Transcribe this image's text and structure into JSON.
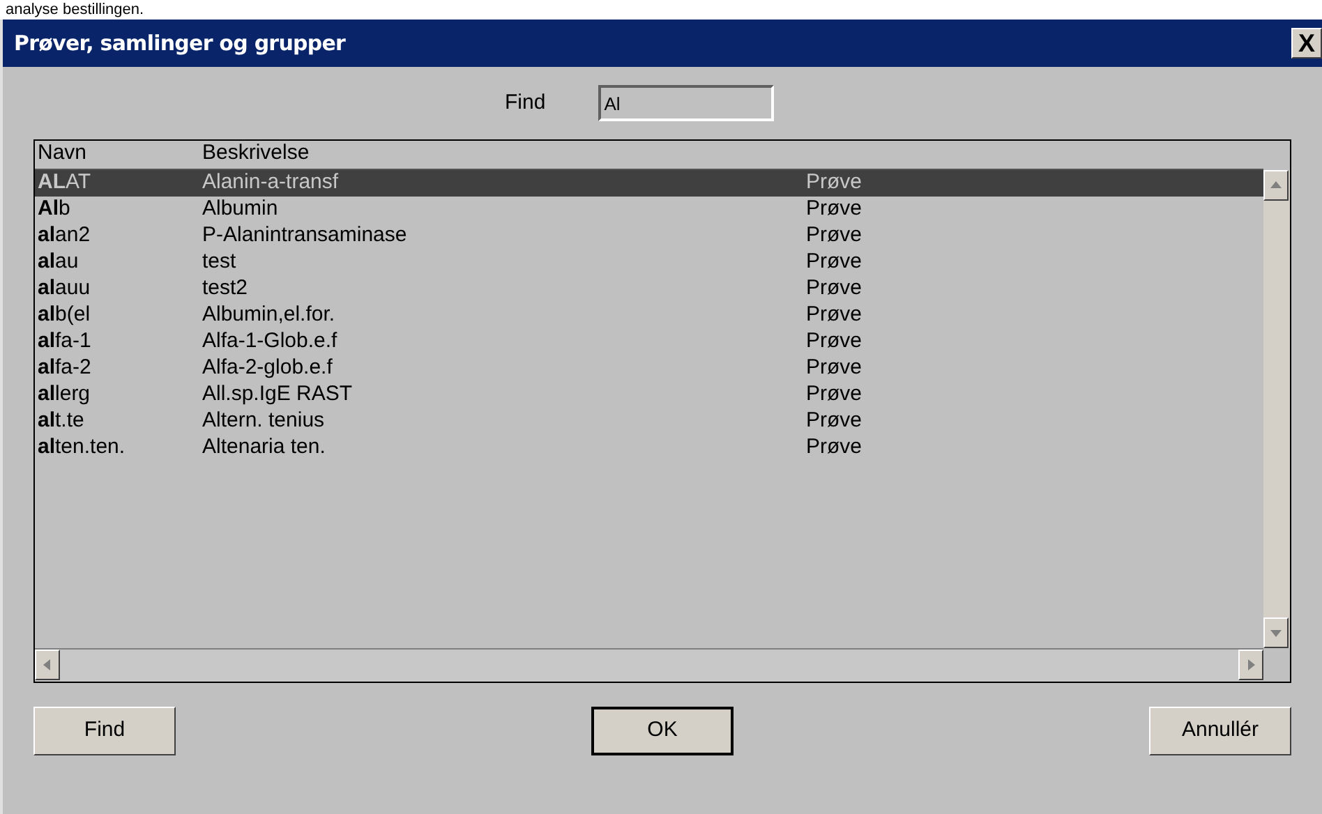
{
  "caption": "analyse bestillingen.",
  "window": {
    "title": "Prøver, samlinger og grupper",
    "close": "X"
  },
  "search": {
    "label": "Find",
    "value": "Al"
  },
  "table": {
    "columns": [
      "Navn",
      "Beskrivelse"
    ],
    "rows": [
      {
        "name": "**AL**AT",
        "description": "Alanin-a-transf",
        "type": "Prøve",
        "selected": true
      },
      {
        "name": "**Al**b",
        "description": "Albumin",
        "type": "Prøve",
        "selected": false
      },
      {
        "name": "**al**an2",
        "description": "P-Alanintransaminase",
        "type": "Prøve",
        "selected": false
      },
      {
        "name": "**al**au",
        "description": "test",
        "type": "Prøve",
        "selected": false
      },
      {
        "name": "**al**auu",
        "description": "test2",
        "type": "Prøve",
        "selected": false
      },
      {
        "name": "**al**b(el",
        "description": "Albumin,el.for.",
        "type": "Prøve",
        "selected": false
      },
      {
        "name": "**al**fa-1",
        "description": "Alfa-1-Glob.e.f",
        "type": "Prøve",
        "selected": false
      },
      {
        "name": "**al**fa-2",
        "description": "Alfa-2-glob.e.f",
        "type": "Prøve",
        "selected": false
      },
      {
        "name": "**al**lerg",
        "description": "All.sp.IgE RAST",
        "type": "Prøve",
        "selected": false
      },
      {
        "name": "**al**t.te",
        "description": "Altern. tenius",
        "type": "Prøve",
        "selected": false
      },
      {
        "name": "**al**ten.ten.",
        "description": "Altenaria ten.",
        "type": "Prøve",
        "selected": false
      }
    ]
  },
  "buttons": [
    {
      "label": "Find",
      "kind": "plain"
    },
    {
      "label": "OK",
      "kind": "default"
    },
    {
      "label": "Annullér",
      "kind": "plain"
    }
  ]
}
